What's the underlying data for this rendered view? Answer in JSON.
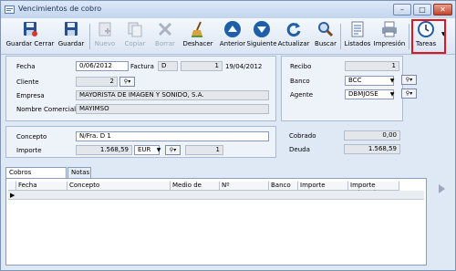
{
  "window": {
    "title": "Vencimientos de cobro",
    "minimize": "–",
    "maximize": "□",
    "close": "✕"
  },
  "toolbar": {
    "buttons": [
      {
        "label": "Guardar Cerrar",
        "icon": "floppy-close-icon",
        "enabled": true
      },
      {
        "label": "Guardar",
        "icon": "floppy-icon",
        "enabled": true
      },
      {
        "label": "Nuevo",
        "icon": "new-document-icon",
        "enabled": false
      },
      {
        "label": "Copiar",
        "icon": "copy-icon",
        "enabled": false
      },
      {
        "label": "Borrar",
        "icon": "delete-icon",
        "enabled": false
      },
      {
        "label": "Deshacer",
        "icon": "undo-broom-icon",
        "enabled": true
      },
      {
        "label": "Anterior",
        "icon": "arrow-up-icon",
        "enabled": true
      },
      {
        "label": "Siguiente",
        "icon": "arrow-down-icon",
        "enabled": true
      },
      {
        "label": "Actualizar",
        "icon": "refresh-icon",
        "enabled": true
      },
      {
        "label": "Buscar",
        "icon": "search-icon",
        "enabled": true
      },
      {
        "label": "Listados",
        "icon": "list-icon",
        "enabled": true
      },
      {
        "label": "Impresión",
        "icon": "printer-icon",
        "enabled": true
      },
      {
        "label": "Tareas",
        "icon": "clock-icon",
        "enabled": true
      }
    ]
  },
  "form": {
    "fecha_label": "Fecha",
    "fecha_value": "0/06/2012",
    "factura_label": "Factura",
    "factura_serie": "D",
    "factura_num": "1",
    "factura_fecha": "19/04/2012",
    "cliente_label": "Cliente",
    "cliente_value": "2",
    "empresa_label": "Empresa",
    "empresa_value": "MAYORISTA DE IMAGEN Y SONIDO, S.A.",
    "nombre_comercial_label": "Nombre Comercial",
    "nombre_comercial_value": "MAYIMSO",
    "recibo_label": "Recibo",
    "recibo_value": "1",
    "banco_label": "Banco",
    "banco_value": "BCC",
    "agente_label": "Agente",
    "agente_value": "DBMJOSE",
    "concepto_label": "Concepto",
    "concepto_value": "N/Fra. D 1",
    "importe_label": "Importe",
    "importe_value": "1.568,59",
    "currency": "EUR",
    "importe_extra": "1",
    "cobrado_label": "Cobrado",
    "cobrado_value": "0,00",
    "deuda_label": "Deuda",
    "deuda_value": "1.568,59"
  },
  "tabs": [
    {
      "label": "Cobros asignados",
      "active": true
    },
    {
      "label": "Notas",
      "active": false
    }
  ],
  "table": {
    "columns": [
      "Fecha",
      "Concepto",
      "Medio de Pago",
      "Nº Documento",
      "Banco",
      "Importe",
      "Importe Asignado"
    ]
  },
  "colors": {
    "highlight": "#e0161c",
    "accent": "#1f5fa8"
  }
}
